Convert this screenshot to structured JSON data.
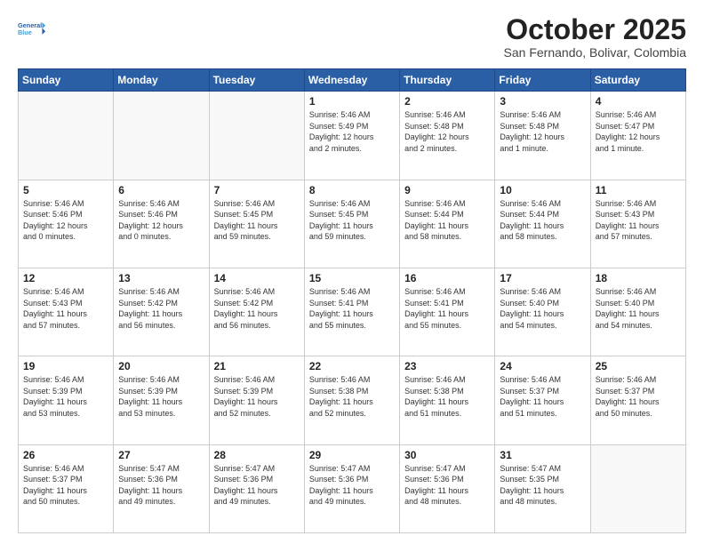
{
  "header": {
    "logo_line1": "General",
    "logo_line2": "Blue",
    "month": "October 2025",
    "location": "San Fernando, Bolivar, Colombia"
  },
  "weekdays": [
    "Sunday",
    "Monday",
    "Tuesday",
    "Wednesday",
    "Thursday",
    "Friday",
    "Saturday"
  ],
  "weeks": [
    [
      {
        "day": "",
        "info": ""
      },
      {
        "day": "",
        "info": ""
      },
      {
        "day": "",
        "info": ""
      },
      {
        "day": "1",
        "info": "Sunrise: 5:46 AM\nSunset: 5:49 PM\nDaylight: 12 hours\nand 2 minutes."
      },
      {
        "day": "2",
        "info": "Sunrise: 5:46 AM\nSunset: 5:48 PM\nDaylight: 12 hours\nand 2 minutes."
      },
      {
        "day": "3",
        "info": "Sunrise: 5:46 AM\nSunset: 5:48 PM\nDaylight: 12 hours\nand 1 minute."
      },
      {
        "day": "4",
        "info": "Sunrise: 5:46 AM\nSunset: 5:47 PM\nDaylight: 12 hours\nand 1 minute."
      }
    ],
    [
      {
        "day": "5",
        "info": "Sunrise: 5:46 AM\nSunset: 5:46 PM\nDaylight: 12 hours\nand 0 minutes."
      },
      {
        "day": "6",
        "info": "Sunrise: 5:46 AM\nSunset: 5:46 PM\nDaylight: 12 hours\nand 0 minutes."
      },
      {
        "day": "7",
        "info": "Sunrise: 5:46 AM\nSunset: 5:45 PM\nDaylight: 11 hours\nand 59 minutes."
      },
      {
        "day": "8",
        "info": "Sunrise: 5:46 AM\nSunset: 5:45 PM\nDaylight: 11 hours\nand 59 minutes."
      },
      {
        "day": "9",
        "info": "Sunrise: 5:46 AM\nSunset: 5:44 PM\nDaylight: 11 hours\nand 58 minutes."
      },
      {
        "day": "10",
        "info": "Sunrise: 5:46 AM\nSunset: 5:44 PM\nDaylight: 11 hours\nand 58 minutes."
      },
      {
        "day": "11",
        "info": "Sunrise: 5:46 AM\nSunset: 5:43 PM\nDaylight: 11 hours\nand 57 minutes."
      }
    ],
    [
      {
        "day": "12",
        "info": "Sunrise: 5:46 AM\nSunset: 5:43 PM\nDaylight: 11 hours\nand 57 minutes."
      },
      {
        "day": "13",
        "info": "Sunrise: 5:46 AM\nSunset: 5:42 PM\nDaylight: 11 hours\nand 56 minutes."
      },
      {
        "day": "14",
        "info": "Sunrise: 5:46 AM\nSunset: 5:42 PM\nDaylight: 11 hours\nand 56 minutes."
      },
      {
        "day": "15",
        "info": "Sunrise: 5:46 AM\nSunset: 5:41 PM\nDaylight: 11 hours\nand 55 minutes."
      },
      {
        "day": "16",
        "info": "Sunrise: 5:46 AM\nSunset: 5:41 PM\nDaylight: 11 hours\nand 55 minutes."
      },
      {
        "day": "17",
        "info": "Sunrise: 5:46 AM\nSunset: 5:40 PM\nDaylight: 11 hours\nand 54 minutes."
      },
      {
        "day": "18",
        "info": "Sunrise: 5:46 AM\nSunset: 5:40 PM\nDaylight: 11 hours\nand 54 minutes."
      }
    ],
    [
      {
        "day": "19",
        "info": "Sunrise: 5:46 AM\nSunset: 5:39 PM\nDaylight: 11 hours\nand 53 minutes."
      },
      {
        "day": "20",
        "info": "Sunrise: 5:46 AM\nSunset: 5:39 PM\nDaylight: 11 hours\nand 53 minutes."
      },
      {
        "day": "21",
        "info": "Sunrise: 5:46 AM\nSunset: 5:39 PM\nDaylight: 11 hours\nand 52 minutes."
      },
      {
        "day": "22",
        "info": "Sunrise: 5:46 AM\nSunset: 5:38 PM\nDaylight: 11 hours\nand 52 minutes."
      },
      {
        "day": "23",
        "info": "Sunrise: 5:46 AM\nSunset: 5:38 PM\nDaylight: 11 hours\nand 51 minutes."
      },
      {
        "day": "24",
        "info": "Sunrise: 5:46 AM\nSunset: 5:37 PM\nDaylight: 11 hours\nand 51 minutes."
      },
      {
        "day": "25",
        "info": "Sunrise: 5:46 AM\nSunset: 5:37 PM\nDaylight: 11 hours\nand 50 minutes."
      }
    ],
    [
      {
        "day": "26",
        "info": "Sunrise: 5:46 AM\nSunset: 5:37 PM\nDaylight: 11 hours\nand 50 minutes."
      },
      {
        "day": "27",
        "info": "Sunrise: 5:47 AM\nSunset: 5:36 PM\nDaylight: 11 hours\nand 49 minutes."
      },
      {
        "day": "28",
        "info": "Sunrise: 5:47 AM\nSunset: 5:36 PM\nDaylight: 11 hours\nand 49 minutes."
      },
      {
        "day": "29",
        "info": "Sunrise: 5:47 AM\nSunset: 5:36 PM\nDaylight: 11 hours\nand 49 minutes."
      },
      {
        "day": "30",
        "info": "Sunrise: 5:47 AM\nSunset: 5:36 PM\nDaylight: 11 hours\nand 48 minutes."
      },
      {
        "day": "31",
        "info": "Sunrise: 5:47 AM\nSunset: 5:35 PM\nDaylight: 11 hours\nand 48 minutes."
      },
      {
        "day": "",
        "info": ""
      }
    ]
  ]
}
